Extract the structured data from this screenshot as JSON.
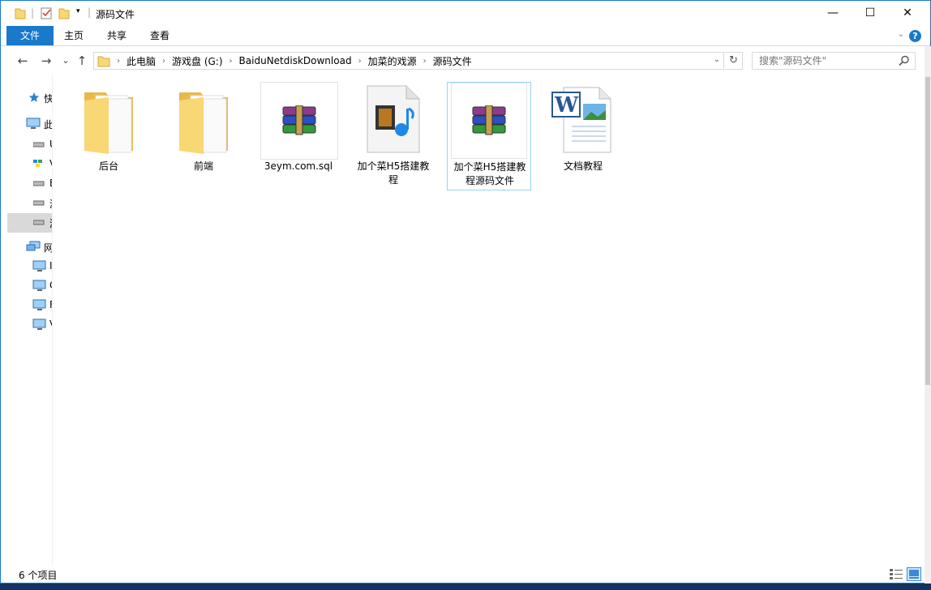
{
  "window": {
    "title": "源码文件",
    "controls": {
      "minimize": "—",
      "maximize": "☐",
      "close": "✕"
    }
  },
  "ribbon": {
    "tabs": [
      {
        "label": "文件",
        "active": true
      },
      {
        "label": "主页"
      },
      {
        "label": "共享"
      },
      {
        "label": "查看"
      }
    ],
    "help": "?"
  },
  "navigation": {
    "back": "←",
    "forward": "→",
    "recent": "⌄",
    "up": "↑",
    "breadcrumb": [
      "此电脑",
      "游戏盘 (G:)",
      "BaiduNetdiskDownload",
      "加菜的戏源",
      "源码文件"
    ],
    "refresh": "↻",
    "search_placeholder": "搜索\"源码文件\""
  },
  "sidebar": {
    "items": [
      {
        "icon": "star-icon",
        "label": "快"
      },
      {
        "icon": "computer-icon",
        "label": "此"
      },
      {
        "icon": "drive-icon",
        "label": "U"
      },
      {
        "icon": "network-drive-icon",
        "label": "V"
      },
      {
        "icon": "drive-icon",
        "label": "B"
      },
      {
        "icon": "drive-icon",
        "label": "游"
      },
      {
        "icon": "drive-icon",
        "label": "游",
        "selected": true
      },
      {
        "icon": "network-icon",
        "label": "网"
      },
      {
        "icon": "monitor-icon",
        "label": "I"
      },
      {
        "icon": "monitor-icon",
        "label": "C"
      },
      {
        "icon": "monitor-icon",
        "label": "F"
      },
      {
        "icon": "monitor-icon",
        "label": "V"
      }
    ]
  },
  "files": [
    {
      "name": "后台",
      "type": "folder"
    },
    {
      "name": "前端",
      "type": "folder"
    },
    {
      "name": "3eym.com.sql",
      "type": "archive"
    },
    {
      "name": "加个菜H5搭建教程",
      "type": "video"
    },
    {
      "name": "加个菜H5搭建教程源码文件",
      "type": "archive",
      "selected": true
    },
    {
      "name": "文档教程",
      "type": "word"
    }
  ],
  "status": {
    "count": "6 个项目"
  },
  "colors": {
    "accent": "#1979ca",
    "folder": "#f8d775",
    "selection_border": "#99d1ff"
  }
}
